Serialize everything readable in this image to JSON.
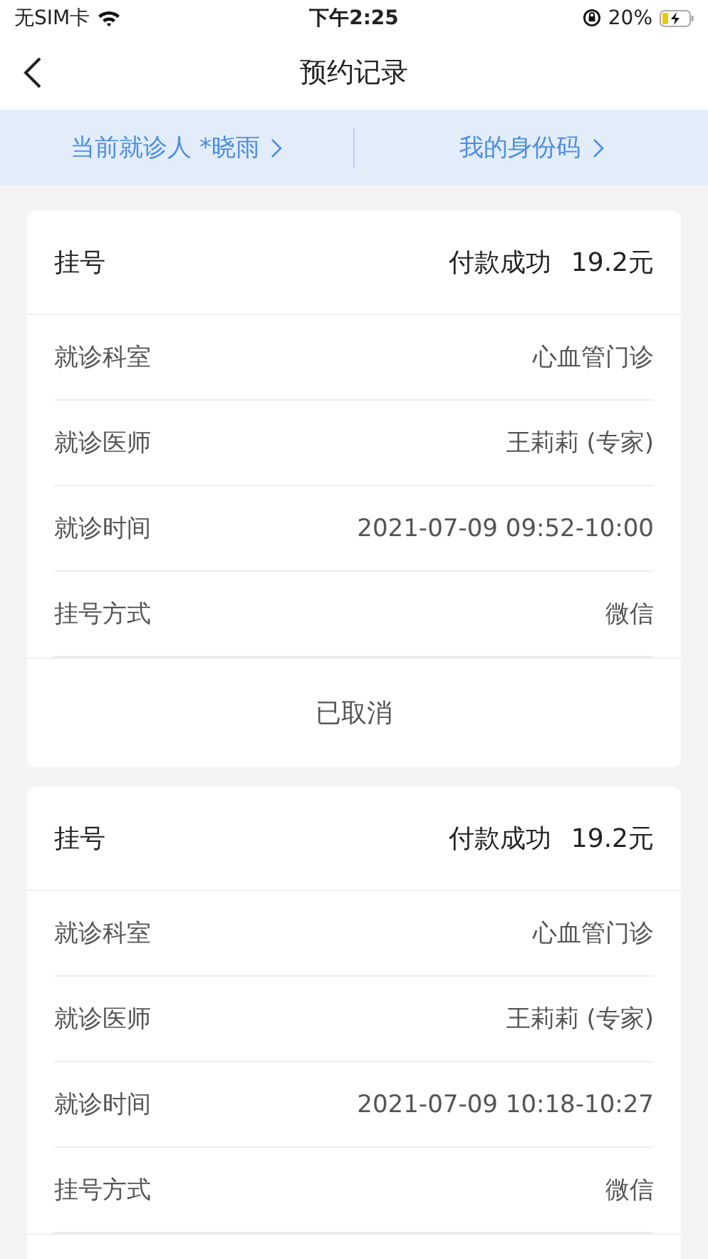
{
  "status_bar": {
    "carrier": "无SIM卡",
    "time": "下午2:25",
    "battery": "20%"
  },
  "nav": {
    "title": "预约记录"
  },
  "info_bar": [
    {
      "label": "当前就诊人 *晓雨"
    },
    {
      "label": "我的身份码"
    }
  ],
  "records": [
    {
      "type": "挂号",
      "payment_status": "付款成功",
      "amount": "19.2元",
      "fields": [
        {
          "label": "就诊科室",
          "value": "心血管门诊"
        },
        {
          "label": "就诊医师",
          "value": "王莉莉 (专家)"
        },
        {
          "label": "就诊时间",
          "value": "2021-07-09 09:52-10:00"
        },
        {
          "label": "挂号方式",
          "value": "微信"
        }
      ],
      "status": "已取消"
    },
    {
      "type": "挂号",
      "payment_status": "付款成功",
      "amount": "19.2元",
      "fields": [
        {
          "label": "就诊科室",
          "value": "心血管门诊"
        },
        {
          "label": "就诊医师",
          "value": "王莉莉 (专家)"
        },
        {
          "label": "就诊时间",
          "value": "2021-07-09 10:18-10:27"
        },
        {
          "label": "挂号方式",
          "value": "微信"
        }
      ]
    }
  ]
}
